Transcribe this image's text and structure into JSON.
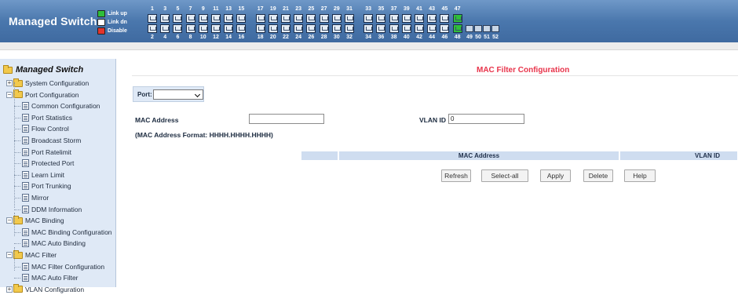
{
  "header": {
    "title": "Managed Switch",
    "legend": [
      {
        "label": "Link up",
        "color": "#2fbf3a"
      },
      {
        "label": "Link dn",
        "color": "#ffffff"
      },
      {
        "label": "Disable",
        "color": "#e2342b"
      }
    ],
    "odd_port_numbers": [
      "1",
      "3",
      "5",
      "7",
      "9",
      "11",
      "13",
      "15",
      "17",
      "19",
      "21",
      "23",
      "25",
      "27",
      "29",
      "31",
      "33",
      "35",
      "37",
      "39",
      "41",
      "43",
      "45",
      "47"
    ],
    "even_port_numbers": [
      "2",
      "4",
      "6",
      "8",
      "10",
      "12",
      "14",
      "16",
      "18",
      "20",
      "22",
      "24",
      "26",
      "28",
      "30",
      "32",
      "34",
      "36",
      "38",
      "40",
      "42",
      "44",
      "46",
      "48"
    ],
    "sfp_port_numbers": [
      "49",
      "50",
      "51",
      "52"
    ],
    "link_up_ports": [
      "47",
      "48"
    ]
  },
  "sidebar": {
    "root": "Managed Switch",
    "items": [
      {
        "label": "System Configuration",
        "kind": "folder",
        "expanded": false
      },
      {
        "label": "Port Configuration",
        "kind": "folder",
        "expanded": true
      },
      {
        "label": "Common Configuration",
        "kind": "page"
      },
      {
        "label": "Port Statistics",
        "kind": "page"
      },
      {
        "label": "Flow Control",
        "kind": "page"
      },
      {
        "label": "Broadcast Storm",
        "kind": "page"
      },
      {
        "label": "Port Ratelimit",
        "kind": "page"
      },
      {
        "label": "Protected Port",
        "kind": "page"
      },
      {
        "label": "Learn Limit",
        "kind": "page"
      },
      {
        "label": "Port Trunking",
        "kind": "page"
      },
      {
        "label": "Mirror",
        "kind": "page"
      },
      {
        "label": "DDM Information",
        "kind": "page"
      },
      {
        "label": "MAC Binding",
        "kind": "folder",
        "expanded": true
      },
      {
        "label": "MAC Binding Configuration",
        "kind": "page"
      },
      {
        "label": "MAC Auto Binding",
        "kind": "page"
      },
      {
        "label": "MAC Filter",
        "kind": "folder",
        "expanded": true
      },
      {
        "label": "MAC Filter Configuration",
        "kind": "page"
      },
      {
        "label": "MAC Auto Filter",
        "kind": "page"
      },
      {
        "label": "VLAN Configuration",
        "kind": "folder",
        "expanded": false
      }
    ]
  },
  "main": {
    "page_title": "MAC Filter Configuration",
    "port_label": "Port:",
    "port_value": "",
    "mac_label": "MAC Address",
    "mac_value": "",
    "vlan_label": "VLAN ID",
    "vlan_value": "0",
    "format_hint": "(MAC Address Format: HHHH.HHHH.HHHH)",
    "table_headers": [
      "",
      "MAC Address",
      "VLAN ID"
    ],
    "buttons": {
      "refresh": "Refresh",
      "select_all": "Select-all",
      "apply": "Apply",
      "delete": "Delete",
      "help": "Help"
    }
  }
}
